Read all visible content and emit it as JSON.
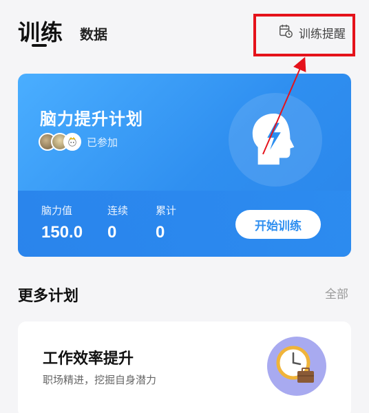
{
  "header": {
    "tab_active": "训练",
    "tab_secondary": "数据",
    "reminder_label": "训练提醒"
  },
  "main_plan": {
    "title": "脑力提升计划",
    "joined_label": "已参加",
    "stats": [
      {
        "label": "脑力值",
        "value": "150.0"
      },
      {
        "label": "连续",
        "value": "0"
      },
      {
        "label": "累计",
        "value": "0"
      }
    ],
    "start_button": "开始训练"
  },
  "more_plans": {
    "title": "更多计划",
    "all_label": "全部",
    "items": [
      {
        "title": "工作效率提升",
        "subtitle": "职场精进，挖掘自身潜力"
      }
    ]
  },
  "colors": {
    "card_blue": "#2f8ff0",
    "highlight_red": "#e5121b",
    "plan_icon_bg": "#a8aaf0"
  },
  "icons": {
    "reminder": "calendar-clock-icon",
    "brain": "head-lightning-icon",
    "plan": "clock-briefcase-icon"
  }
}
